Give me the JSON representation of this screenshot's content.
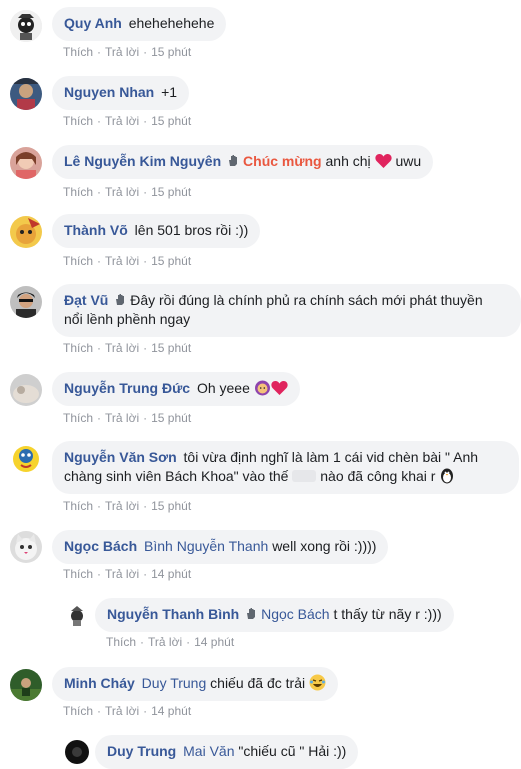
{
  "actions": {
    "like": "Thích",
    "reply": "Trả lời"
  },
  "comments": [
    {
      "author": "Quy Anh",
      "text": "ehehehehehe",
      "time": "15 phút"
    },
    {
      "author": "Nguyen Nhan",
      "text": "+1",
      "time": "15 phút"
    },
    {
      "author": "Lê Nguyễn Kim Nguyên",
      "highlight": "Chúc mừng",
      "text": "anh chị",
      "text2": "uwu",
      "time": "15 phút"
    },
    {
      "author": "Thành Võ",
      "text": "lên 501 bros rồi :))",
      "time": "15 phút"
    },
    {
      "author": "Đạt Vũ",
      "text": "Đây rồi đúng là chính phủ ra chính sách mới phát thuyền",
      "text_line2": "nổi lềnh phềnh ngay",
      "time": "15 phút"
    },
    {
      "author": "Nguyễn Trung Đức",
      "text": "Oh yeee",
      "time": "15 phút"
    },
    {
      "author": "Nguyễn Văn Sơn",
      "text": "tôi vừa định nghĩ là làm 1 cái vid chèn bài \" Anh",
      "text_line2": "chàng sinh viên Bách Khoa\" vào thế",
      "text_line2b": "nào đã công khai r",
      "time": "15 phút"
    },
    {
      "author": "Ngọc Bách",
      "mention": "Bình Nguyễn Thanh",
      "text": "well xong rồi :))))",
      "time": "14 phút"
    },
    {
      "author": "Nguyễn Thanh Bình",
      "mention": "Ngọc Bách",
      "text": "t thấy từ nãy r :)))",
      "time": "14 phút"
    },
    {
      "author": "Minh Cháy",
      "mention": "Duy Trung",
      "text": "chiếu đã đc trải",
      "time": "14 phút"
    },
    {
      "author": "Duy Trung",
      "mention": "Mai Văn",
      "text": "\"chiếu cũ \" Hải :))"
    }
  ],
  "colors": {
    "author": "#385898",
    "bubble": "#f2f3f5",
    "meta": "#90949c",
    "highlight": "#e9573f",
    "heart": "#e0245e"
  }
}
